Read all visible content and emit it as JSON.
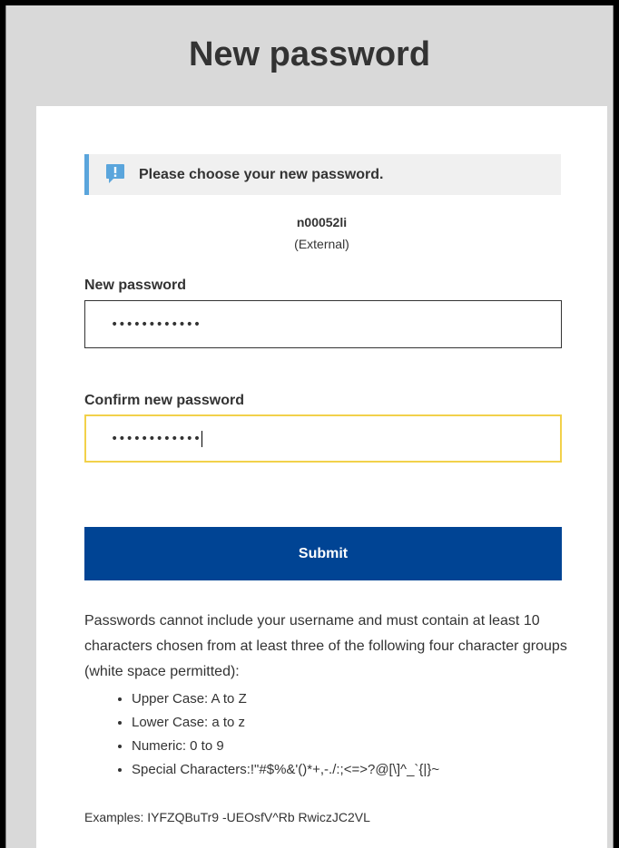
{
  "page": {
    "title": "New password"
  },
  "banner": {
    "icon": "exclamation-speech-bubble-icon",
    "message": "Please choose your new password."
  },
  "user": {
    "username": "n00052li",
    "type": "(External)"
  },
  "form": {
    "new_password_label": "New password",
    "new_password_value": "••••••••••••",
    "confirm_password_label": "Confirm new password",
    "confirm_password_value": "••••••••••••",
    "submit_label": "Submit"
  },
  "rules": {
    "intro": "Passwords cannot include your username and must contain at least 10 characters chosen from at least three of the following four character groups (white space permitted):",
    "groups": [
      "Upper Case: A to Z",
      "Lower Case: a to z",
      "Numeric: 0 to 9",
      "Special Characters:!\"#$%&'()*+,-./:;<=>?@[\\]^_`{|}~"
    ],
    "examples": "Examples: IYFZQBuTr9 -UEOsfV^Rb RwiczJC2VL"
  },
  "colors": {
    "page_background": "#d9d9d9",
    "card_background": "#ffffff",
    "banner_background": "#f0f0f0",
    "banner_accent": "#5aa5dc",
    "submit_background": "#004494",
    "focus_border": "#f2d14a",
    "text": "#333333"
  }
}
